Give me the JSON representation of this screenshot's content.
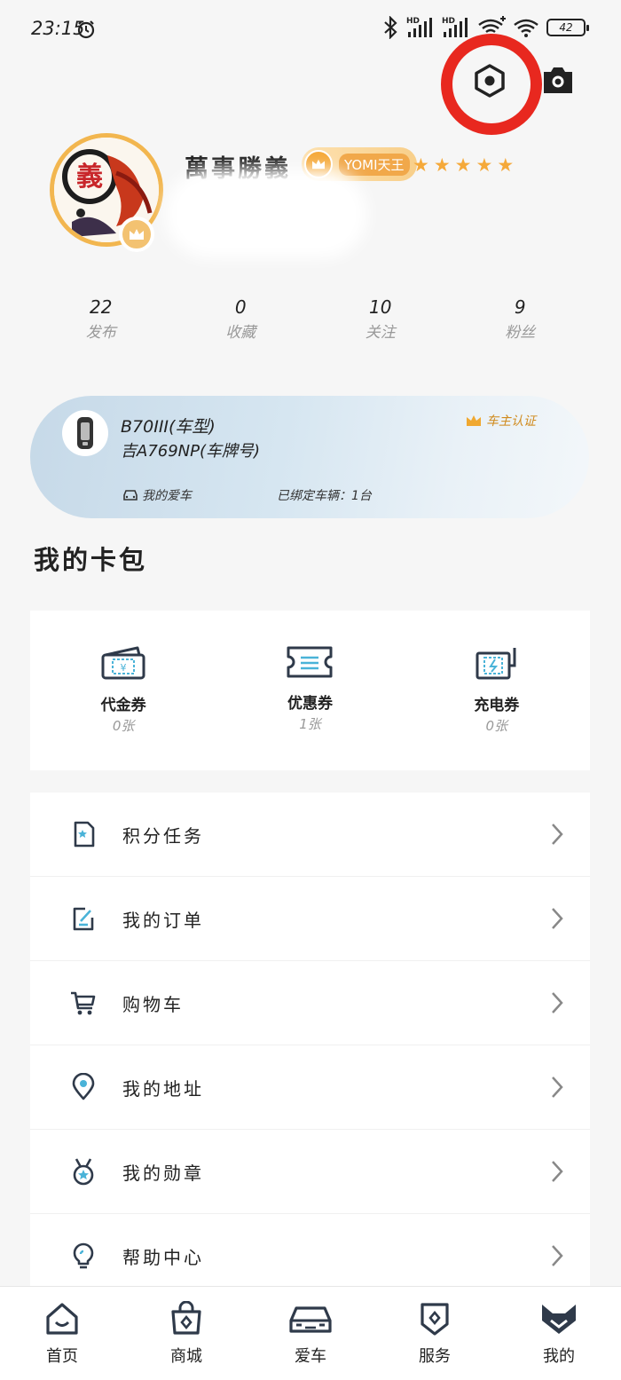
{
  "status_bar": {
    "time": "23:15",
    "battery": "42",
    "hd1": "HD",
    "hd2": "HD"
  },
  "profile": {
    "username": "萬事勝義",
    "level_label": "YOMI天王",
    "stars": 5
  },
  "stats": [
    {
      "value": "22",
      "label": "发布"
    },
    {
      "value": "0",
      "label": "收藏"
    },
    {
      "value": "10",
      "label": "关注"
    },
    {
      "value": "9",
      "label": "粉丝"
    }
  ],
  "car": {
    "model": "B70III(车型)",
    "plate": "吉A769NP(车牌号)",
    "owner_cert": "车主认证",
    "my_car": "我的爱车",
    "bound": "已绑定车辆：1台"
  },
  "wallet": {
    "title": "我的卡包",
    "items": [
      {
        "label": "代金券",
        "count": "0张",
        "icon": "voucher-icon"
      },
      {
        "label": "优惠券",
        "count": "1张",
        "icon": "coupon-icon"
      },
      {
        "label": "充电券",
        "count": "0张",
        "icon": "charging-coupon-icon"
      }
    ]
  },
  "menu": [
    {
      "label": "积分任务",
      "icon": "points-task-icon"
    },
    {
      "label": "我的订单",
      "icon": "order-icon"
    },
    {
      "label": "购物车",
      "icon": "cart-icon"
    },
    {
      "label": "我的地址",
      "icon": "location-icon"
    },
    {
      "label": "我的勋章",
      "icon": "medal-icon"
    },
    {
      "label": "帮助中心",
      "icon": "lightbulb-icon"
    }
  ],
  "nav": [
    {
      "label": "首页",
      "icon": "home-icon"
    },
    {
      "label": "商城",
      "icon": "shop-bag-icon"
    },
    {
      "label": "爱车",
      "icon": "car-icon"
    },
    {
      "label": "服务",
      "icon": "service-shield-icon"
    },
    {
      "label": "我的",
      "icon": "fox-profile-icon"
    }
  ],
  "colors": {
    "accent": "#f5a93a",
    "highlight_ring": "#e8281f",
    "card_blue": "#c6d9e8"
  }
}
